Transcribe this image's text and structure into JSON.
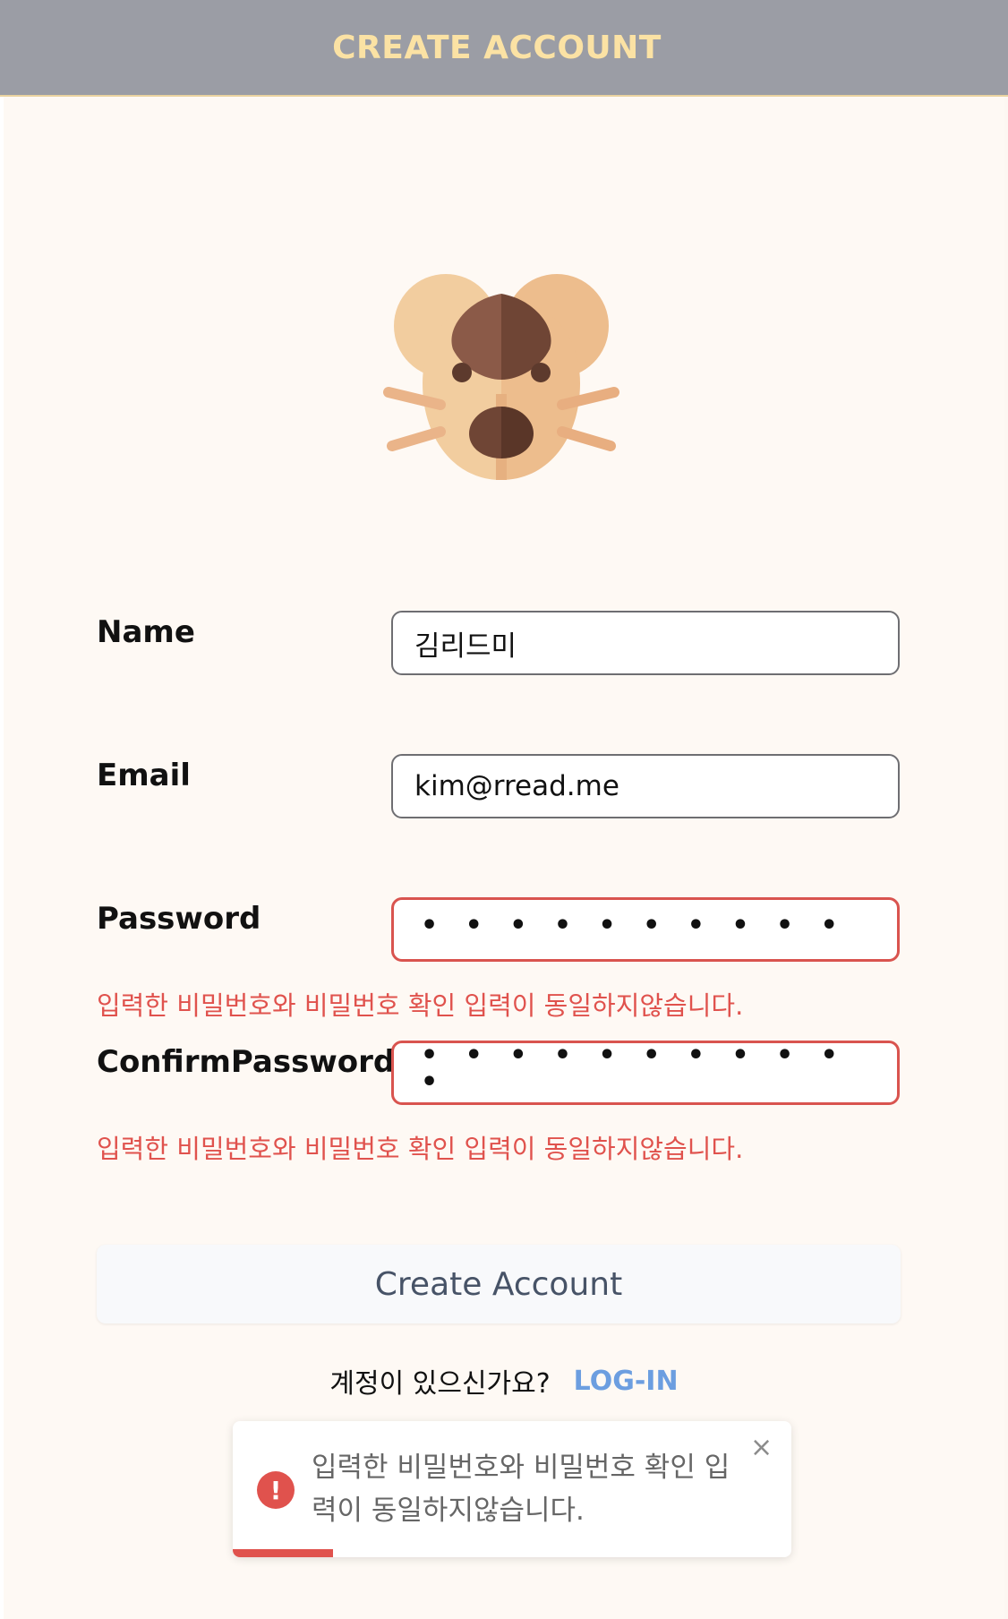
{
  "header": {
    "title": "CREATE ACCOUNT"
  },
  "form": {
    "name": {
      "label": "Name",
      "value": "김리드미"
    },
    "email": {
      "label": "Email",
      "value": "kim@rread.me"
    },
    "password": {
      "label": "Password",
      "masked_value": "• • • • • • • • • •",
      "error": "입력한 비밀번호와 비밀번호 확인 입력이 동일하지않습니다."
    },
    "confirm_password": {
      "label": "ConfirmPassword",
      "masked_value": "• • • • • • • • • • •",
      "error": "입력한 비밀번호와 비밀번호 확인 입력이 동일하지않습니다."
    },
    "submit_label": "Create Account"
  },
  "login": {
    "question": "계정이 있으신가요?",
    "link_label": "LOG-IN"
  },
  "toast": {
    "icon": "!",
    "message": "입력한 비밀번호와 비밀번호 확인 입력이 동일하지않습니다.",
    "close_label": "×",
    "progress": 0.18
  },
  "colors": {
    "header_bg": "#9b9da5",
    "header_text": "#fbe2a4",
    "error": "#e0524d",
    "link": "#6c9ee0"
  }
}
